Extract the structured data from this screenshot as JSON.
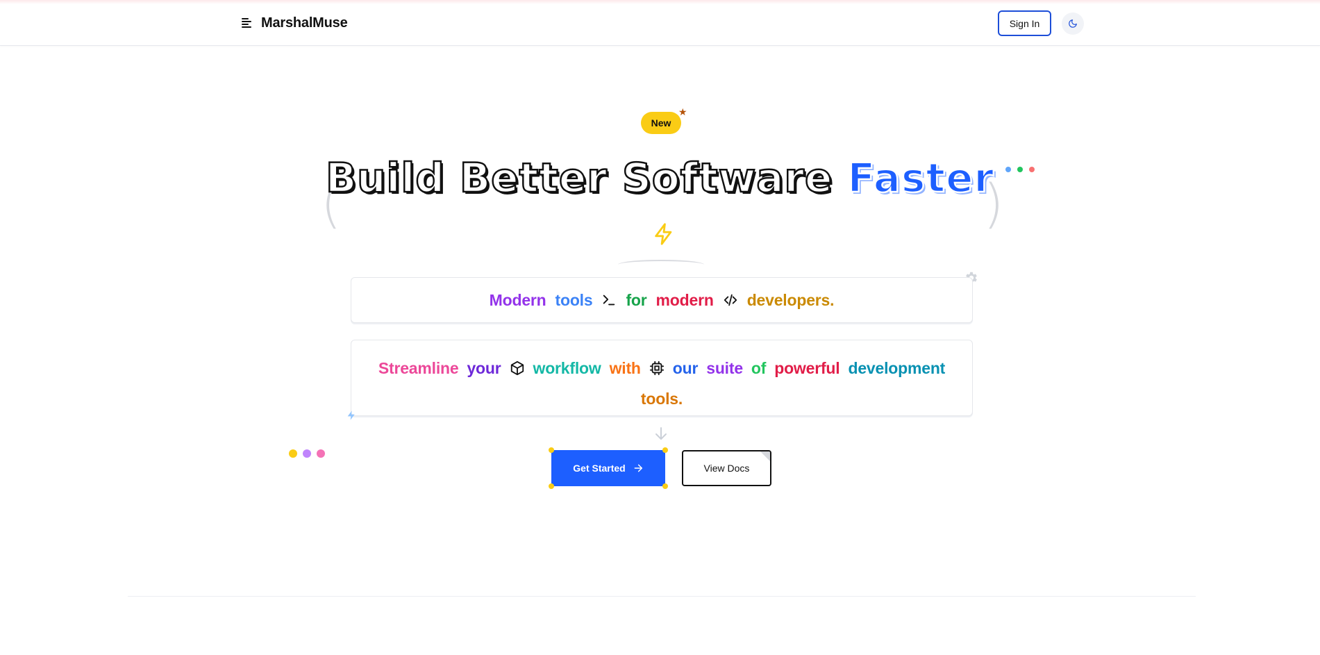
{
  "nav": {
    "brand": "MarshalMuse",
    "sign_in": "Sign In",
    "menu_icon": "menu-icon",
    "theme_icon": "moon-icon"
  },
  "hero": {
    "badge": "New",
    "headline": "Build Better Software",
    "headline_accent": "Faster",
    "tagline": {
      "words": [
        {
          "text": "Modern",
          "color": "#9333ea"
        },
        {
          "text": "tools",
          "color": "#3b82f6"
        },
        {
          "text": "for",
          "color": "#16a34a"
        },
        {
          "text": "modern",
          "color": "#e11d48"
        },
        {
          "text": "developers.",
          "color": "#ca8a04"
        }
      ],
      "icons": [
        "terminal-icon",
        "code-icon"
      ]
    },
    "description": {
      "words": [
        {
          "text": "Streamline",
          "color": "#ec4899"
        },
        {
          "text": "your",
          "color": "#6d28d9"
        },
        {
          "text": "workflow",
          "color": "#14b8a6"
        },
        {
          "text": "with",
          "color": "#f97316"
        },
        {
          "text": "our",
          "color": "#2563eb"
        },
        {
          "text": "suite",
          "color": "#9333ea"
        },
        {
          "text": "of",
          "color": "#22c55e"
        },
        {
          "text": "powerful",
          "color": "#e11d48"
        },
        {
          "text": "development",
          "color": "#0891b2"
        },
        {
          "text": "tools.",
          "color": "#d97706"
        }
      ],
      "icons": [
        "box-icon",
        "cpu-icon"
      ]
    },
    "cta_primary": "Get Started",
    "cta_secondary": "View Docs"
  },
  "colors": {
    "accent": "#1d5fff",
    "badge": "#facc15",
    "dots_top_right": [
      "#60a5fa",
      "#22c55e",
      "#f87171"
    ],
    "dots_left": [
      "#facc15",
      "#c084fc",
      "#f472b6"
    ]
  }
}
